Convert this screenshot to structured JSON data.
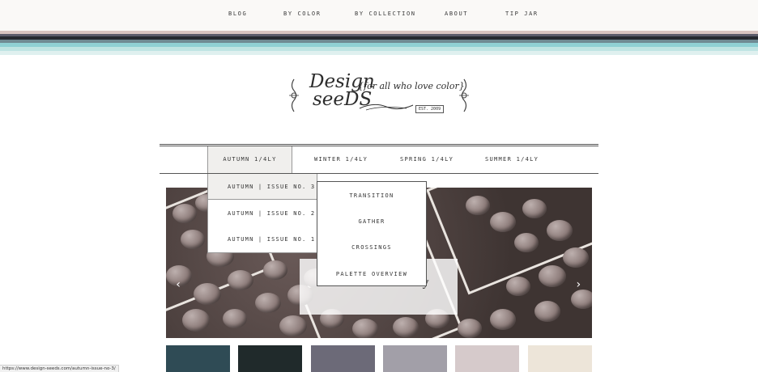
{
  "topnav": {
    "items": [
      "BLOG",
      "BY COLOR",
      "BY COLLECTION",
      "ABOUT",
      "TIP JAR"
    ]
  },
  "stripes": [
    "#d8c4c0",
    "#5b5b6a",
    "#262a31",
    "#6f8a93",
    "#8fd0d4",
    "#bfe4e3",
    "#dff0ef"
  ],
  "logo": {
    "line1": "Design",
    "line2": "seeDS",
    "tagline": "{for all who love color}",
    "est": "EST. 2009"
  },
  "subnav": {
    "items": [
      "AUTUMN 1/4LY",
      "WINTER 1/4LY",
      "SPRING 1/4LY",
      "SUMMER 1/4LY"
    ]
  },
  "dropdown_issues": [
    "AUTUMN | ISSUE NO. 3",
    "AUTUMN | ISSUE NO. 2",
    "AUTUMN | ISSUE NO. 1"
  ],
  "dropdown_sections": [
    "TRANSITION",
    "GATHER",
    "CROSSINGS",
    "PALETTE OVERVIEW"
  ],
  "hero": {
    "caption": "The Seasonal Play",
    "prev_arrow": "‹",
    "next_arrow": "›"
  },
  "swatches": [
    "#2f4b55",
    "#202a2b",
    "#6c6a78",
    "#a29fa8",
    "#d6cacb",
    "#ede5d9"
  ],
  "status_url": "https://www.design-seeds.com/autumn-issue-no-3/"
}
